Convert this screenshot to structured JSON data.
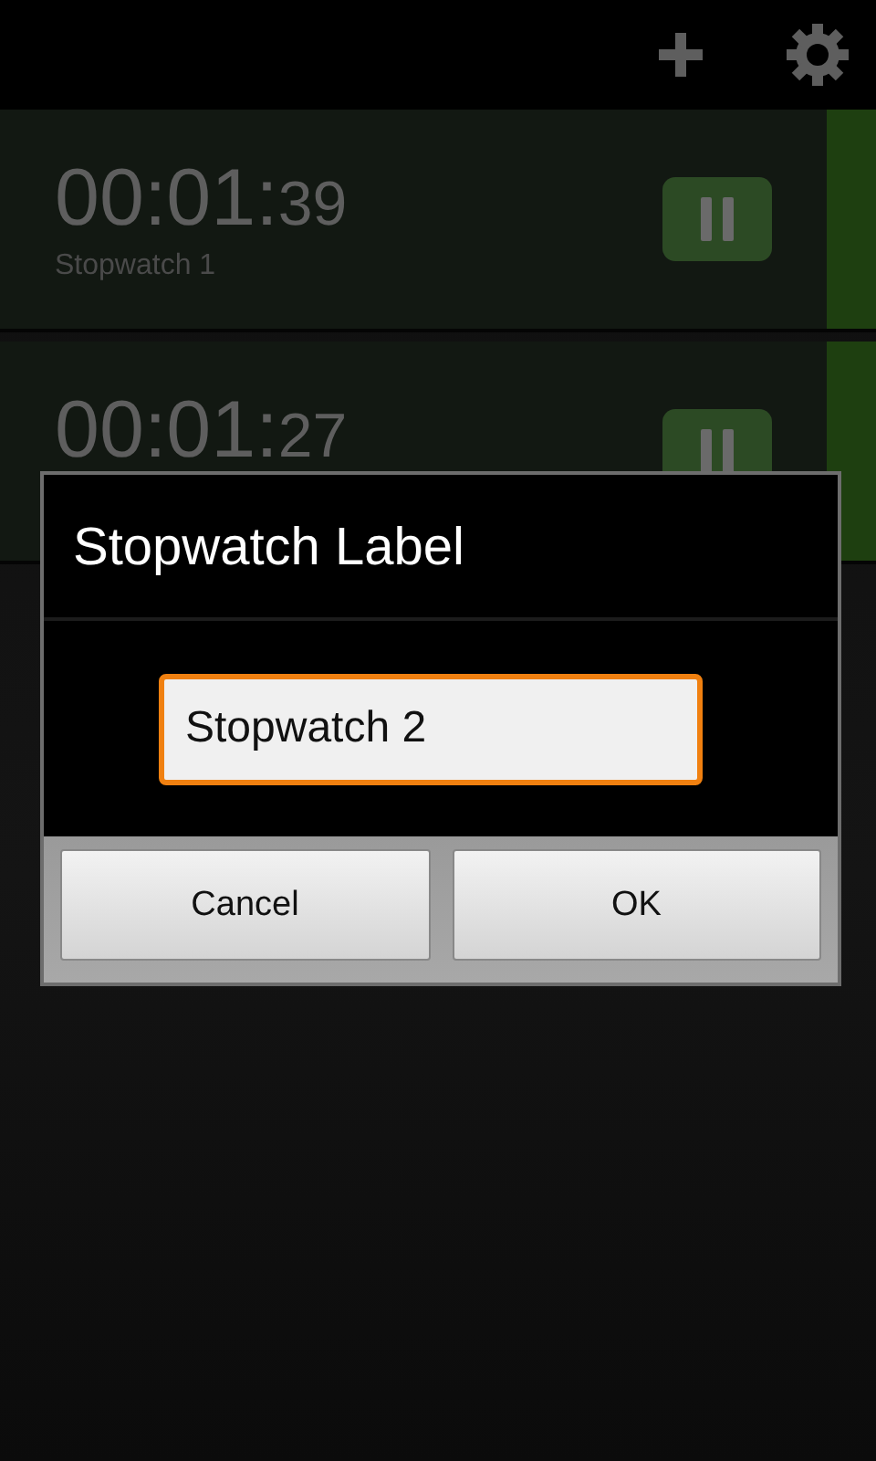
{
  "toolbar": {
    "actions": [
      {
        "kind": "add"
      },
      {
        "kind": "settings"
      }
    ]
  },
  "stopwatches": [
    {
      "time_main": "00:01:",
      "time_fraction": "39",
      "label": "Stopwatch 1",
      "running": true
    },
    {
      "time_main": "00:01:",
      "time_fraction": "27",
      "running": true
    }
  ],
  "dialog": {
    "title": "Stopwatch Label",
    "field": {
      "value": "Stopwatch 2",
      "focused": true
    },
    "buttons": [
      "Cancel",
      "OK"
    ]
  }
}
